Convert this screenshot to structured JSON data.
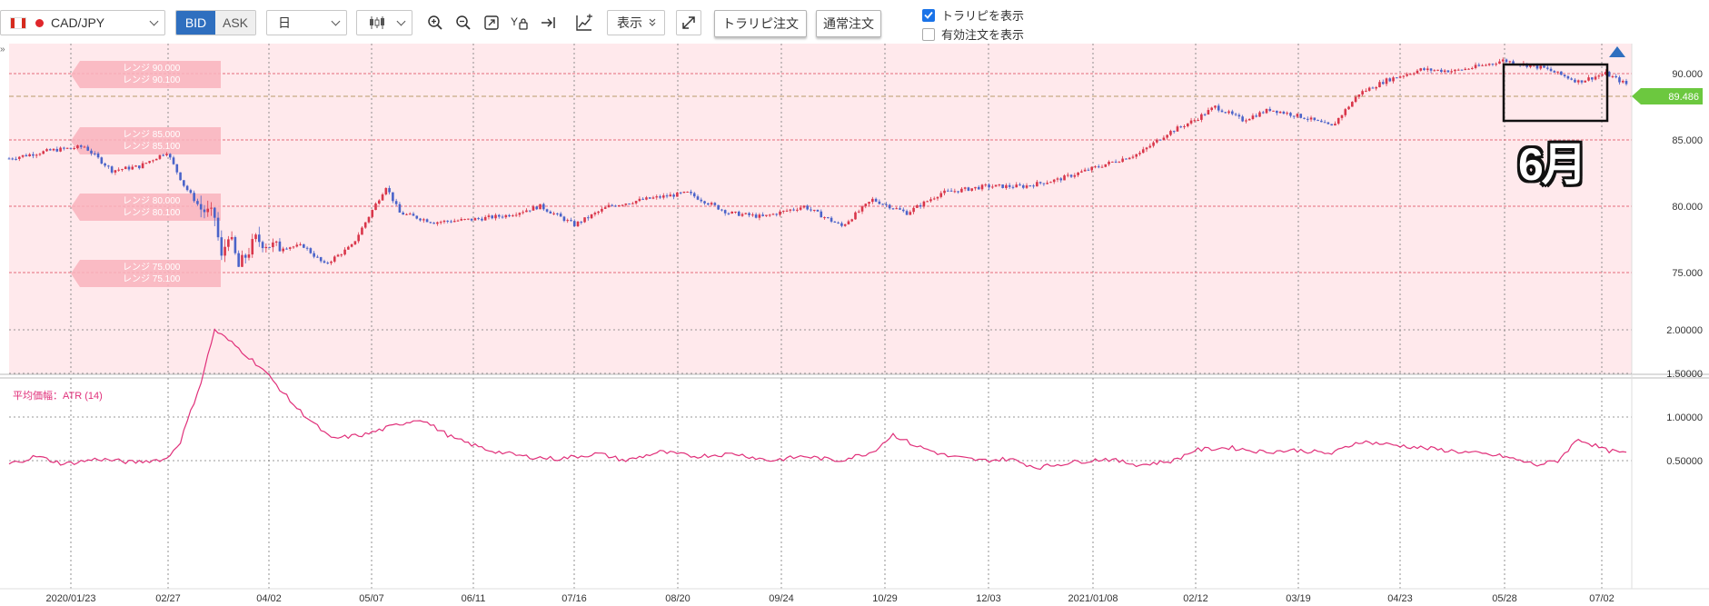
{
  "toolbar": {
    "symbol": "CAD/JPY",
    "bid_label": "BID",
    "ask_label": "ASK",
    "period": "日",
    "display_label": "表示",
    "trap_order_label": "トラリピ注文",
    "normal_order_label": "通常注文",
    "show_trap_label": "トラリピを表示",
    "show_trap_checked": true,
    "show_valid_orders_label": "有効注文を表示",
    "show_valid_orders_checked": false
  },
  "colors": {
    "accent_blue": "#2f6fbf",
    "up_candle": "#d9364a",
    "down_candle": "#4a63c9",
    "atr_line": "#e0307a",
    "range_band": "#ffe9ec",
    "range_line": "#e66a7a",
    "current_price_tag": "#6cc83f"
  },
  "range_tags": [
    {
      "label": "レンジ 90.000"
    },
    {
      "label": "レンジ 90.100"
    },
    {
      "label": "レンジ 85.000"
    },
    {
      "label": "レンジ 85.100"
    },
    {
      "label": "レンジ 80.000"
    },
    {
      "label": "レンジ 80.100"
    },
    {
      "label": "レンジ 75.000"
    },
    {
      "label": "レンジ 75.100"
    }
  ],
  "annotation": "6月",
  "chart_data": [
    {
      "type": "candlestick",
      "series": [
        {
          "name": "CAD/JPY"
        }
      ],
      "y_ticks": [
        "90.000",
        "85.000",
        "80.000",
        "75.000"
      ],
      "ylim": [
        72.0,
        93.0
      ],
      "current_price": "89.486",
      "horizontal_lines": [
        90.0,
        85.0,
        80.0,
        75.0
      ],
      "x_ticks": [
        "2020/01/23",
        "02/27",
        "04/02",
        "05/07",
        "06/11",
        "07/16",
        "08/20",
        "09/24",
        "10/29",
        "12/03",
        "2021/01/08",
        "02/12",
        "03/19",
        "04/23",
        "05/28",
        "07/02"
      ],
      "close_path": [
        [
          0,
          83.6
        ],
        [
          12,
          84.2
        ],
        [
          22,
          84.5
        ],
        [
          30,
          82.7
        ],
        [
          38,
          83.0
        ],
        [
          46,
          84.1
        ],
        [
          51,
          81.6
        ],
        [
          56,
          79.8
        ],
        [
          60,
          79.2
        ],
        [
          62,
          76.0
        ],
        [
          64,
          78.0
        ],
        [
          67,
          75.4
        ],
        [
          72,
          77.5
        ],
        [
          78,
          76.9
        ],
        [
          86,
          77.0
        ],
        [
          92,
          75.6
        ],
        [
          100,
          77.0
        ],
        [
          110,
          81.5
        ],
        [
          114,
          79.5
        ],
        [
          124,
          78.8
        ],
        [
          135,
          79.0
        ],
        [
          145,
          79.3
        ],
        [
          155,
          80.0
        ],
        [
          165,
          78.6
        ],
        [
          175,
          80.0
        ],
        [
          185,
          80.5
        ],
        [
          198,
          81.0
        ],
        [
          210,
          79.5
        ],
        [
          220,
          79.2
        ],
        [
          232,
          80.0
        ],
        [
          243,
          78.5
        ],
        [
          252,
          80.5
        ],
        [
          262,
          79.5
        ],
        [
          272,
          81.0
        ],
        [
          285,
          81.5
        ],
        [
          296,
          81.5
        ],
        [
          306,
          82.0
        ],
        [
          318,
          83.0
        ],
        [
          330,
          84.0
        ],
        [
          338,
          85.5
        ],
        [
          346,
          86.5
        ],
        [
          352,
          87.5
        ],
        [
          360,
          86.5
        ],
        [
          368,
          87.3
        ],
        [
          378,
          86.7
        ],
        [
          386,
          86.0
        ],
        [
          394,
          88.5
        ],
        [
          402,
          89.5
        ],
        [
          412,
          90.3
        ],
        [
          422,
          90.2
        ],
        [
          430,
          90.6
        ],
        [
          436,
          91.0
        ],
        [
          448,
          90.4
        ],
        [
          458,
          89.4
        ],
        [
          466,
          90.0
        ],
        [
          472,
          89.2
        ]
      ]
    },
    {
      "type": "line",
      "title": "平均価幅：ATR (14)",
      "series": [
        {
          "name": "ATR (14)"
        }
      ],
      "y_ticks": [
        "2.00000",
        "1.50000",
        "1.00000",
        "0.50000"
      ],
      "ylim": [
        0.0,
        2.1
      ],
      "values_path": [
        [
          0,
          0.46
        ],
        [
          8,
          0.55
        ],
        [
          16,
          0.46
        ],
        [
          26,
          0.52
        ],
        [
          36,
          0.48
        ],
        [
          46,
          0.52
        ],
        [
          50,
          0.72
        ],
        [
          56,
          1.4
        ],
        [
          60,
          2.0
        ],
        [
          66,
          1.82
        ],
        [
          74,
          1.55
        ],
        [
          84,
          1.1
        ],
        [
          94,
          0.75
        ],
        [
          104,
          0.8
        ],
        [
          114,
          0.92
        ],
        [
          120,
          0.98
        ],
        [
          130,
          0.75
        ],
        [
          140,
          0.62
        ],
        [
          150,
          0.55
        ],
        [
          160,
          0.52
        ],
        [
          172,
          0.58
        ],
        [
          180,
          0.5
        ],
        [
          190,
          0.6
        ],
        [
          200,
          0.55
        ],
        [
          212,
          0.58
        ],
        [
          222,
          0.5
        ],
        [
          232,
          0.55
        ],
        [
          242,
          0.5
        ],
        [
          252,
          0.6
        ],
        [
          258,
          0.8
        ],
        [
          264,
          0.68
        ],
        [
          274,
          0.55
        ],
        [
          284,
          0.5
        ],
        [
          292,
          0.52
        ],
        [
          300,
          0.42
        ],
        [
          310,
          0.48
        ],
        [
          320,
          0.52
        ],
        [
          330,
          0.45
        ],
        [
          340,
          0.5
        ],
        [
          346,
          0.62
        ],
        [
          356,
          0.65
        ],
        [
          366,
          0.6
        ],
        [
          376,
          0.62
        ],
        [
          386,
          0.58
        ],
        [
          394,
          0.72
        ],
        [
          404,
          0.68
        ],
        [
          414,
          0.64
        ],
        [
          424,
          0.6
        ],
        [
          436,
          0.55
        ],
        [
          446,
          0.45
        ],
        [
          452,
          0.5
        ],
        [
          458,
          0.75
        ],
        [
          466,
          0.62
        ],
        [
          472,
          0.58
        ]
      ]
    }
  ]
}
